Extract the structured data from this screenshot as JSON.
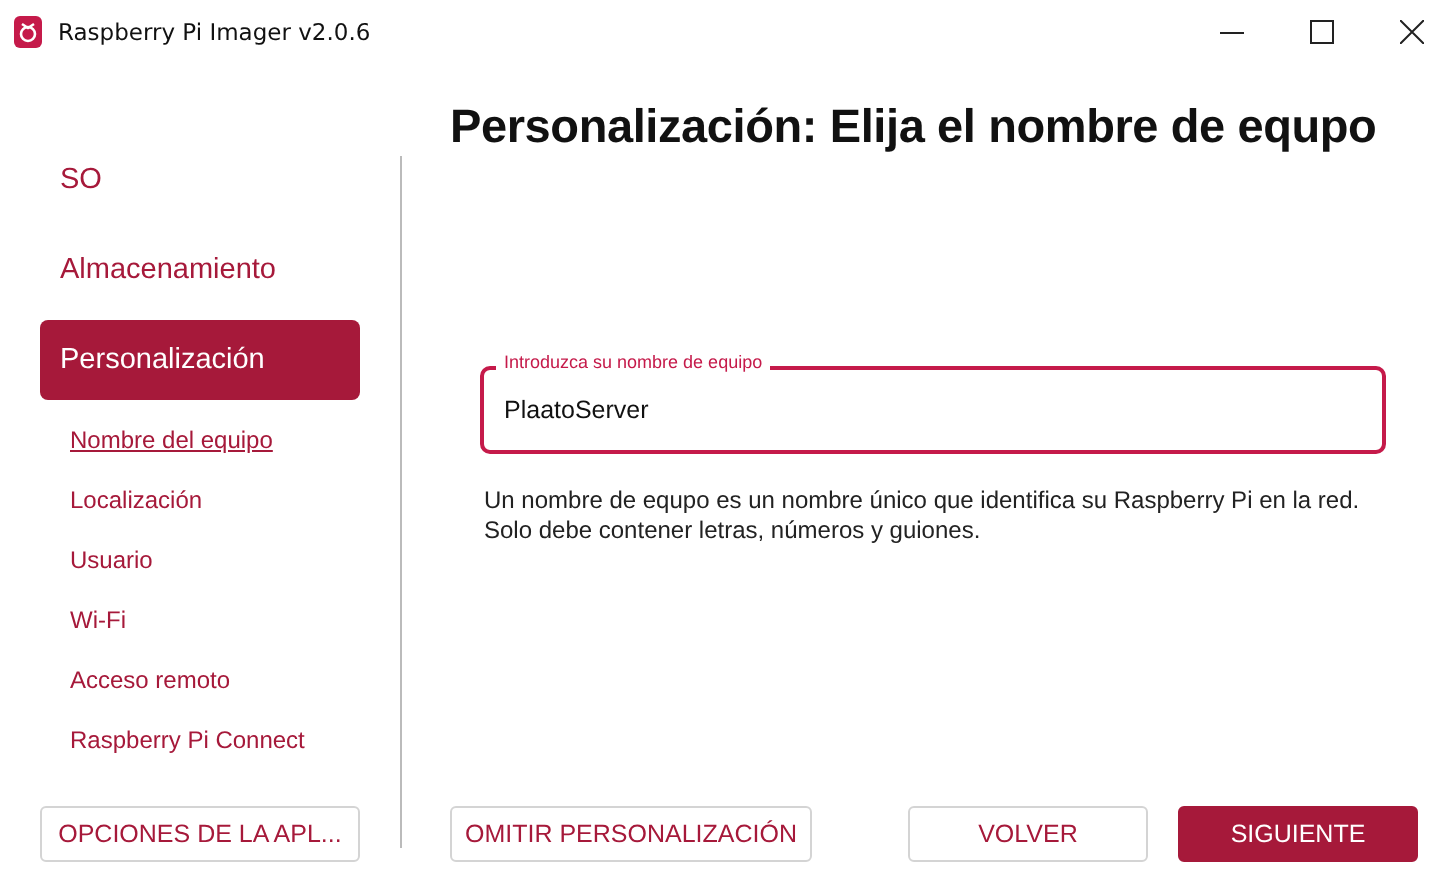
{
  "window": {
    "title": "Raspberry Pi Imager v2.0.6"
  },
  "sidebar": {
    "sections": [
      {
        "label": "SO",
        "selected": false
      },
      {
        "label": "Almacenamiento",
        "selected": false
      },
      {
        "label": "Personalización",
        "selected": true
      }
    ],
    "subitems": [
      {
        "label": "Nombre del equipo",
        "selected": true
      },
      {
        "label": "Localización",
        "selected": false
      },
      {
        "label": "Usuario",
        "selected": false
      },
      {
        "label": "Wi-Fi",
        "selected": false
      },
      {
        "label": "Acceso remoto",
        "selected": false
      },
      {
        "label": "Raspberry Pi Connect",
        "selected": false
      }
    ]
  },
  "heading": "Personalización: Elija el nombre de equpo",
  "field": {
    "label": "Introduzca su nombre de equipo",
    "value": "PlaatoServer"
  },
  "help": [
    "Un nombre de equpo es un nombre único que identifica su Raspberry Pi en la red.",
    "Solo debe contener letras, números y guiones."
  ],
  "buttons": [
    {
      "label": "OPCIONES DE LA APL...",
      "kind": "outline"
    },
    {
      "label": "OMITIR PERSONALIZACIÓN",
      "kind": "outline"
    },
    {
      "label": "VOLVER",
      "kind": "outline"
    },
    {
      "label": "SIGUIENTE",
      "kind": "primary"
    }
  ]
}
